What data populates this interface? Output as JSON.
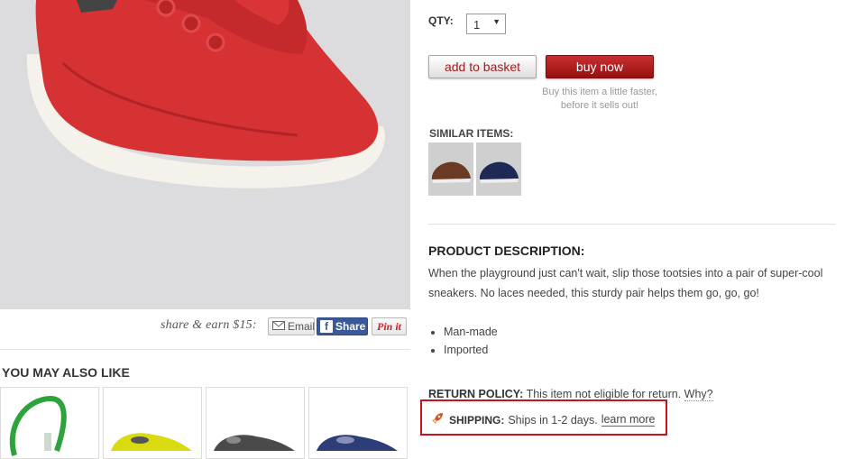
{
  "share": {
    "text": "share & earn $15:",
    "email_label": "Email",
    "facebook_label": "Share",
    "pinterest_label": "Pin it"
  },
  "recommendations": {
    "title": "YOU MAY ALSO LIKE"
  },
  "purchase": {
    "qty_label": "QTY:",
    "qty_value": "1",
    "add_to_basket": "add to basket",
    "buy_now": "buy now",
    "buy_note": "Buy this item a little faster, before it sells out!"
  },
  "similar": {
    "label": "SIMILAR ITEMS:"
  },
  "description": {
    "title": "PRODUCT DESCRIPTION:",
    "text": "When the playground just can't wait, slip those tootsies into a pair of super-cool sneakers. No laces needed, this sturdy pair helps them go, go, go!",
    "features": [
      "Man-made",
      "Imported"
    ]
  },
  "return_policy": {
    "label": "RETURN POLICY:",
    "text": "This item not eligible for return.",
    "why": "Why?"
  },
  "shipping": {
    "label": "SHIPPING:",
    "text": "Ships in 1-2 days.",
    "learn_more": "learn more"
  },
  "colors": {
    "accent_red": "#b31b1b",
    "highlight_border": "#c7141a",
    "facebook_blue": "#3b5998"
  }
}
